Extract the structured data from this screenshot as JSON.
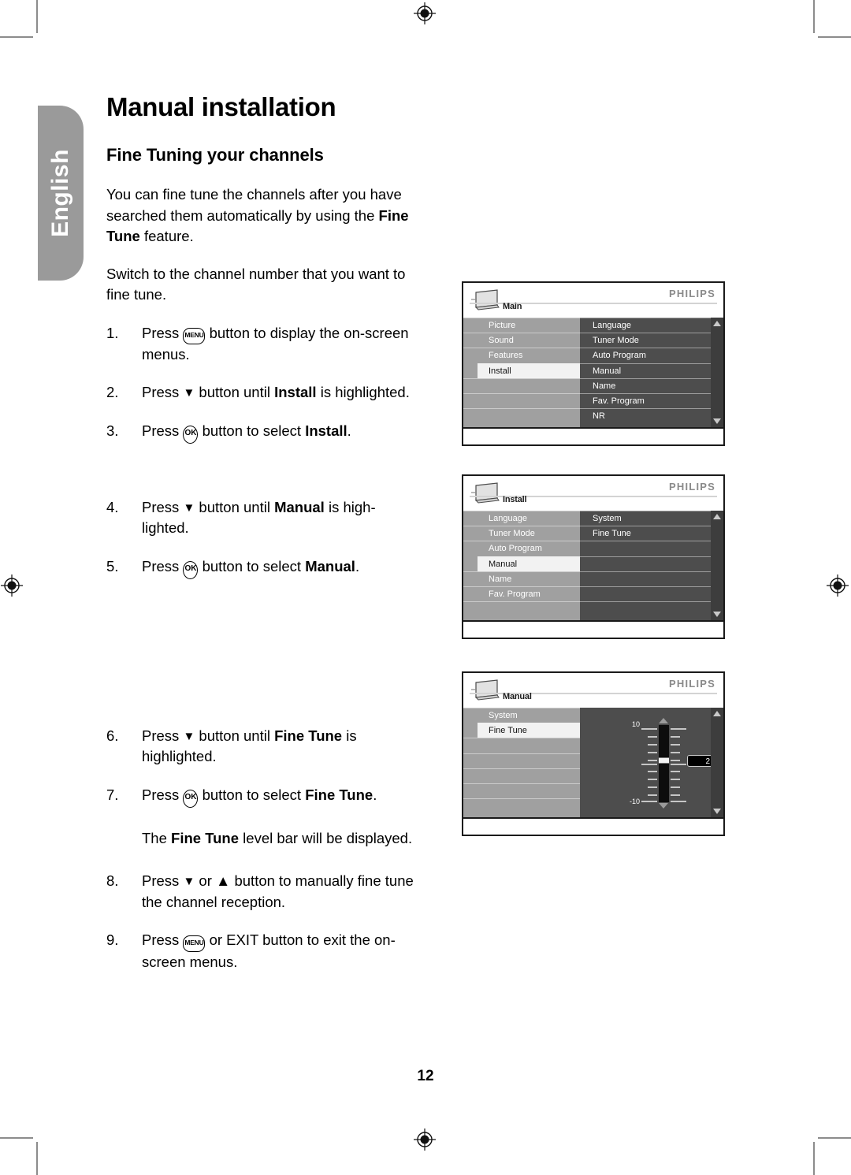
{
  "page": {
    "language_tab": "English",
    "title": "Manual installation",
    "section_title": "Fine Tuning your channels",
    "page_number": "12"
  },
  "intro": {
    "p1_a": "You can fine tune the channels after you have searched them automatically by using the ",
    "p1_bold": "Fine Tune",
    "p1_b": " feature.",
    "p2": "Switch to the channel number that you want to fine tune."
  },
  "steps": [
    {
      "num": "1.",
      "pre": "Press ",
      "icon": "menu-button-icon",
      "icon_label": "MENU",
      "post": " button to display the on-screen menus.",
      "bold": "",
      "tail": ""
    },
    {
      "num": "2.",
      "pre": "Press ",
      "icon": "arrow-down-icon",
      "icon_label": "▼",
      "post": " button until ",
      "bold": "Install",
      "tail": " is highlighted."
    },
    {
      "num": "3.",
      "pre": "Press ",
      "icon": "ok-button-icon",
      "icon_label": "OK",
      "post": " button to select ",
      "bold": "Install",
      "tail": "."
    },
    {
      "num": "4.",
      "pre": "Press ",
      "icon": "arrow-down-icon",
      "icon_label": "▼",
      "post": " button until ",
      "bold": "Manual",
      "tail": " is high-lighted."
    },
    {
      "num": "5.",
      "pre": "Press ",
      "icon": "ok-button-icon",
      "icon_label": "OK",
      "post": " button to select ",
      "bold": "Manual",
      "tail": "."
    },
    {
      "num": "6.",
      "pre": "Press ",
      "icon": "arrow-down-icon",
      "icon_label": "▼",
      "post": " button until ",
      "bold": "Fine Tune",
      "tail": " is highlighted."
    },
    {
      "num": "7.",
      "pre": "Press ",
      "icon": "ok-button-icon",
      "icon_label": "OK",
      "post": " button to select ",
      "bold": "Fine Tune",
      "tail": "."
    },
    {
      "num": "8.",
      "pre": "Press ",
      "icon": "arrow-down-icon",
      "icon_label": "▼",
      "post": " or ▲ button to manually fine tune the channel reception.",
      "bold": "",
      "tail": ""
    },
    {
      "num": "9.",
      "pre": "Press ",
      "icon": "menu-button-icon",
      "icon_label": "MENU",
      "post": " or EXIT button to exit the on-screen menus.",
      "bold": "",
      "tail": ""
    }
  ],
  "note": {
    "pre": "The ",
    "bold": "Fine Tune",
    "post": " level bar will be displayed."
  },
  "osd_common": {
    "brand": "PHILIPS",
    "tv_icon": "tv-set-icon",
    "scroll_up_icon": "scroll-up-arrow-icon",
    "scroll_down_icon": "scroll-down-arrow-icon"
  },
  "osd1": {
    "crumb": "Main",
    "left_items": [
      "Picture",
      "Sound",
      "Features",
      "Install"
    ],
    "left_selected": "Install",
    "right_items": [
      "Language",
      "Tuner Mode",
      "Auto Program",
      "Manual",
      "Name",
      "Fav. Program",
      "NR"
    ],
    "left_blank_rows": 3,
    "right_blank_rows": 0
  },
  "osd2": {
    "crumb": "Install",
    "left_items": [
      "Language",
      "Tuner Mode",
      "Auto Program",
      "Manual",
      "Name",
      "Fav. Program"
    ],
    "left_selected": "Manual",
    "right_items": [
      "System",
      "Fine Tune"
    ],
    "left_blank_rows": 1,
    "right_blank_rows": 5
  },
  "osd3": {
    "crumb": "Manual",
    "left_items": [
      "System",
      "Fine Tune"
    ],
    "left_selected": "Fine Tune",
    "left_blank_rows": 5,
    "level_bar": {
      "max_label": "10",
      "min_label": "-10",
      "value": "2",
      "max": 10,
      "min": -10,
      "current": 2,
      "up_caret": "level-up-caret-icon",
      "down_caret": "level-down-caret-icon"
    }
  }
}
